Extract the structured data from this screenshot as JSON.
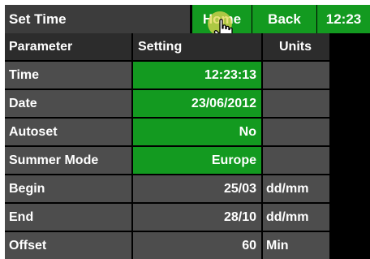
{
  "header": {
    "title": "Set Time",
    "home_label": "Home",
    "back_label": "Back",
    "clock": "12:23"
  },
  "table": {
    "columns": [
      "Parameter",
      "Setting",
      "Units"
    ],
    "rows": [
      {
        "parameter": "Time",
        "setting": "12:23:13",
        "units": "",
        "editable": true
      },
      {
        "parameter": "Date",
        "setting": "23/06/2012",
        "units": "",
        "editable": true
      },
      {
        "parameter": "Autoset",
        "setting": "No",
        "units": "",
        "editable": true
      },
      {
        "parameter": "Summer Mode",
        "setting": "Europe",
        "units": "",
        "editable": true
      },
      {
        "parameter": "Begin",
        "setting": "25/03",
        "units": "dd/mm",
        "editable": false
      },
      {
        "parameter": "End",
        "setting": "28/10",
        "units": "dd/mm",
        "editable": false
      },
      {
        "parameter": "Offset",
        "setting": "60",
        "units": "Min",
        "editable": false
      }
    ]
  },
  "colors": {
    "accent_green": "#139a20",
    "cell_grey": "#4d4d4d",
    "header_grey": "#2c2c2c",
    "background": "#000000"
  },
  "icons": {
    "pointer": "hand-pointer-icon"
  }
}
